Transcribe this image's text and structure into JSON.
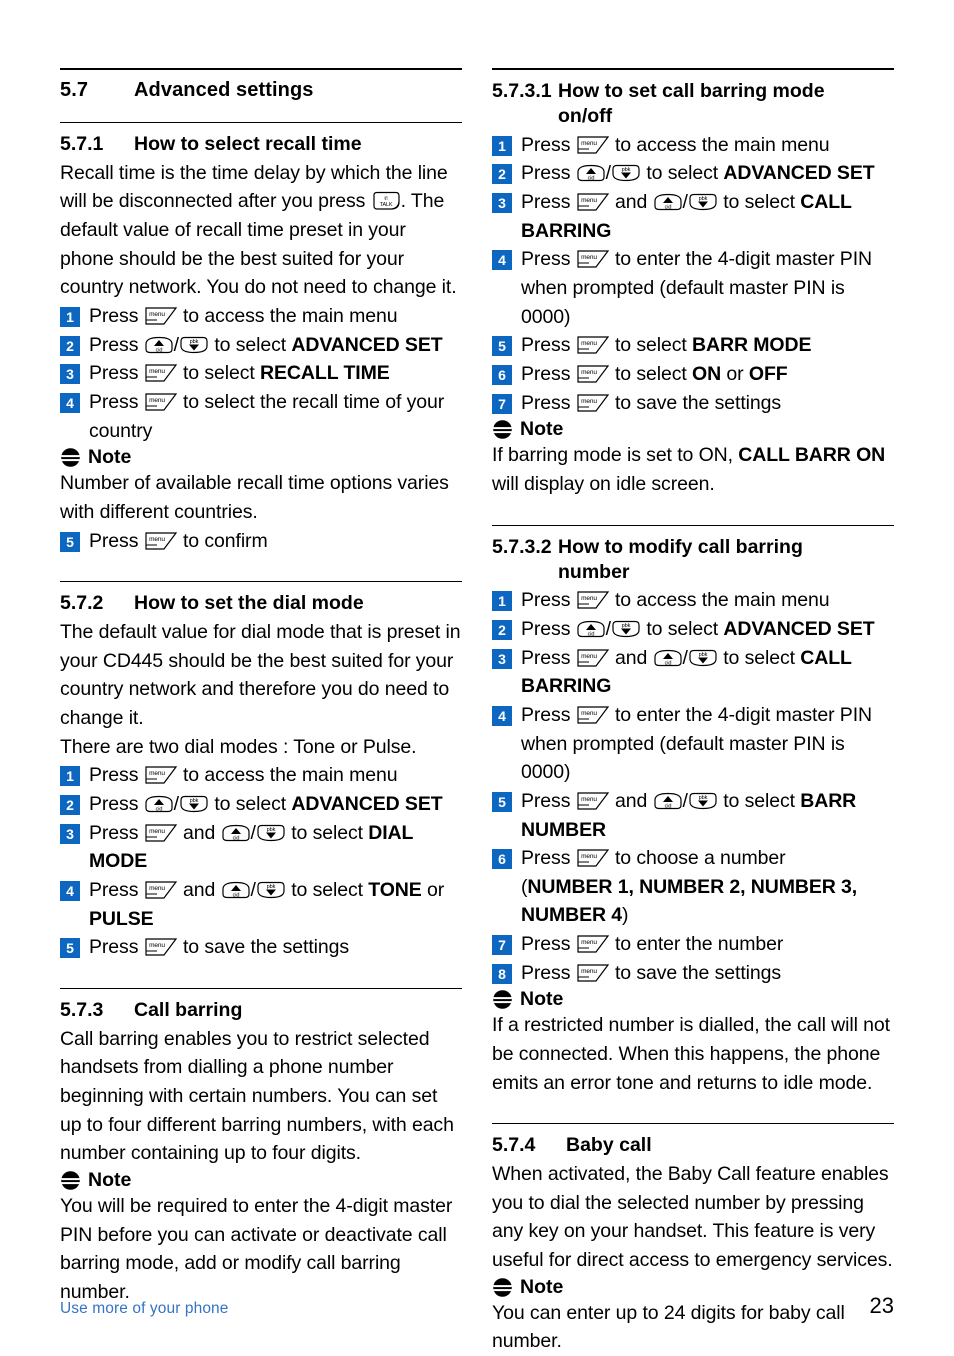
{
  "document": {
    "footer_left": "Use more of your phone",
    "page_number": "23",
    "accent_color": "#0d66bf",
    "footer_link_color": "#3573c4"
  },
  "icons": {
    "menu_key": "menu-softkey-icon",
    "up_key": "up-cid-key-icon",
    "down_key": "down-pbk-key-icon",
    "talk_key": "talk-key-icon",
    "note": "note-icon",
    "menu_key_label": "menu",
    "up_key_label": "cid",
    "down_key_label": "pbk",
    "talk_key_label": "TALK"
  },
  "left_column": {
    "section_major": {
      "number": "5.7",
      "title": "Advanced settings"
    },
    "section_571": {
      "number": "5.7.1",
      "title": "How to select recall time",
      "intro_part1": "Recall time is the time delay by which the line will be disconnected after you press ",
      "intro_part2": ". The default value of recall time preset in your phone should be the best suited for your country network. You do not need to change it.",
      "steps": [
        {
          "n": "1",
          "pre": "Press ",
          "keys": [
            "menu"
          ],
          "post": " to access the main menu",
          "bold": ""
        },
        {
          "n": "2",
          "pre": "Press ",
          "keys": [
            "up",
            "down"
          ],
          "post": " to select ",
          "bold": "ADVANCED SET"
        },
        {
          "n": "3",
          "pre": "Press ",
          "keys": [
            "menu"
          ],
          "post": " to select ",
          "bold": "RECALL TIME"
        },
        {
          "n": "4",
          "pre": "Press ",
          "keys": [
            "menu"
          ],
          "post": " to select the recall time of your country",
          "bold": ""
        }
      ],
      "note_label": "Note",
      "note_text": "Number of available recall time options varies with different countries.",
      "step_after_note": {
        "n": "5",
        "pre": "Press ",
        "keys": [
          "menu"
        ],
        "post": " to confirm",
        "bold": ""
      }
    },
    "section_572": {
      "number": "5.7.2",
      "title": "How to set the dial mode",
      "intro": "The default value for dial mode that is preset in your CD445 should be the best suited for your country network and therefore you do need to change it.",
      "intro2": "There are two dial modes : Tone or Pulse.",
      "steps": [
        {
          "n": "1",
          "pre": "Press ",
          "keys": [
            "menu"
          ],
          "post": " to access the main menu",
          "bold": ""
        },
        {
          "n": "2",
          "pre": "Press ",
          "keys": [
            "up",
            "down"
          ],
          "post": " to select ",
          "bold": "ADVANCED SET"
        },
        {
          "n": "3",
          "pre": "Press ",
          "keys": [
            "menu",
            "and",
            "up",
            "down"
          ],
          "post": " to select ",
          "bold": "DIAL MODE"
        },
        {
          "n": "4",
          "pre": "Press ",
          "keys": [
            "menu",
            "and",
            "up",
            "down"
          ],
          "post": " to select ",
          "bold": "TONE",
          "tail": " or ",
          "bold2": "PULSE"
        },
        {
          "n": "5",
          "pre": "Press ",
          "keys": [
            "menu"
          ],
          "post": " to save the settings",
          "bold": ""
        }
      ]
    },
    "section_573": {
      "number": "5.7.3",
      "title": "Call barring",
      "intro": "Call barring enables you to restrict selected handsets from dialling a phone number beginning with certain numbers. You can set up to four different barring numbers, with each number containing up to four digits.",
      "note_label": "Note",
      "note_text": "You will be required to enter the 4-digit master PIN before you can activate or deactivate call barring mode, add or modify call barring number."
    }
  },
  "right_column": {
    "section_5731": {
      "number": "5.7.3.1",
      "title_line1": "How to set call barring mode",
      "title_line2": "on/off",
      "steps": [
        {
          "n": "1",
          "pre": "Press ",
          "keys": [
            "menu"
          ],
          "post": " to access the main menu",
          "bold": ""
        },
        {
          "n": "2",
          "pre": "Press ",
          "keys": [
            "up",
            "down"
          ],
          "post": " to select ",
          "bold": "ADVANCED SET"
        },
        {
          "n": "3",
          "pre": "Press ",
          "keys": [
            "menu",
            "and",
            "up",
            "down"
          ],
          "post": " to select ",
          "bold": "CALL BARRING"
        },
        {
          "n": "4",
          "pre": "Press ",
          "keys": [
            "menu"
          ],
          "post": " to enter the 4-digit master PIN when prompted (default master PIN is 0000)",
          "bold": ""
        },
        {
          "n": "5",
          "pre": "Press ",
          "keys": [
            "menu"
          ],
          "post": " to select ",
          "bold": "BARR MODE"
        },
        {
          "n": "6",
          "pre": "Press ",
          "keys": [
            "menu"
          ],
          "post": " to select ",
          "bold": "ON",
          "tail": " or ",
          "bold2": "OFF"
        },
        {
          "n": "7",
          "pre": "Press ",
          "keys": [
            "menu"
          ],
          "post": " to save the settings",
          "bold": ""
        }
      ],
      "note_label": "Note",
      "note_pre": "If barring mode is set to ON, ",
      "note_bold": "CALL BARR ON",
      "note_post": " will display on idle screen."
    },
    "section_5732": {
      "number": "5.7.3.2",
      "title_line1": "How to modify call barring",
      "title_line2": "number",
      "steps": [
        {
          "n": "1",
          "pre": "Press ",
          "keys": [
            "menu"
          ],
          "post": " to access the main menu",
          "bold": ""
        },
        {
          "n": "2",
          "pre": "Press ",
          "keys": [
            "up",
            "down"
          ],
          "post": " to select ",
          "bold": "ADVANCED SET"
        },
        {
          "n": "3",
          "pre": "Press ",
          "keys": [
            "menu",
            "and",
            "up",
            "down"
          ],
          "post": " to select ",
          "bold": "CALL BARRING"
        },
        {
          "n": "4",
          "pre": "Press ",
          "keys": [
            "menu"
          ],
          "post": " to enter the 4-digit master PIN when prompted (default master PIN is 0000)",
          "bold": ""
        },
        {
          "n": "5",
          "pre": "Press ",
          "keys": [
            "menu",
            "and",
            "up",
            "down"
          ],
          "post": " to select ",
          "bold": "BARR NUMBER"
        },
        {
          "n": "6",
          "pre": "Press ",
          "keys": [
            "menu"
          ],
          "post": " to choose a number",
          "bold": "",
          "second_line_pre": "(",
          "second_line_bold": "NUMBER 1, NUMBER 2, NUMBER 3, NUMBER 4",
          "second_line_post": ")"
        },
        {
          "n": "7",
          "pre": "Press ",
          "keys": [
            "menu"
          ],
          "post": " to enter the number",
          "bold": ""
        },
        {
          "n": "8",
          "pre": "Press ",
          "keys": [
            "menu"
          ],
          "post": " to save the settings",
          "bold": ""
        }
      ],
      "note_label": "Note",
      "note_text": "If a restricted number is dialled, the call will not be connected. When this happens, the phone emits an error tone and returns to idle mode."
    },
    "section_574": {
      "number": "5.7.4",
      "title": "Baby call",
      "intro": "When activated, the Baby Call feature enables you to dial the selected number by pressing any key on your handset. This feature is very useful for direct access to emergency services.",
      "note_label": "Note",
      "note_text": "You can enter up to 24 digits for baby call number."
    }
  }
}
